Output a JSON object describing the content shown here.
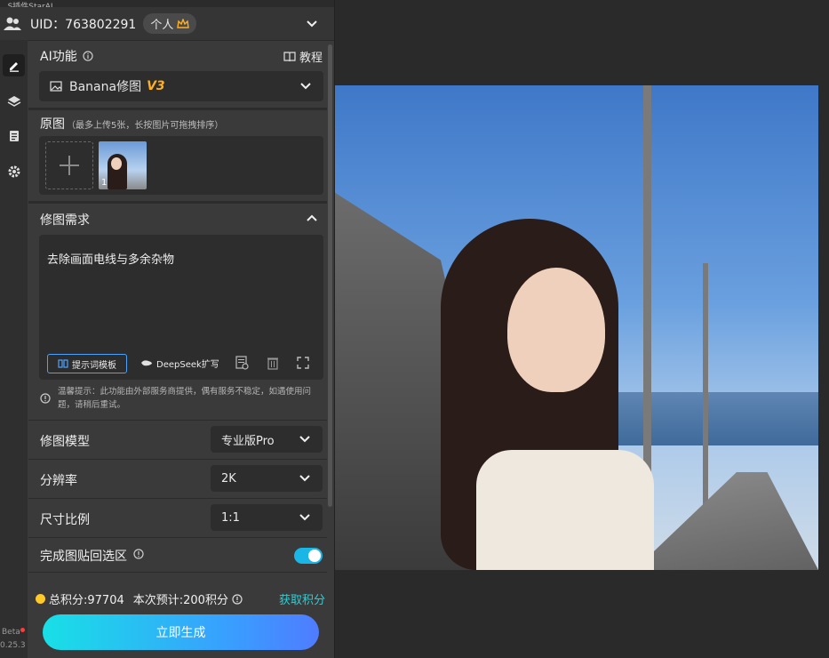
{
  "window": {
    "title": "...S插件StarAI"
  },
  "account": {
    "uid_label": "UID：763802291",
    "tier": "个人"
  },
  "section_ai": {
    "title": "AI功能",
    "tutorial_label": "教程",
    "feature_selected": "Banana修图",
    "feature_version": "V3"
  },
  "section_source": {
    "title": "原图",
    "hint": "（最多上传5张，长按图片可拖拽排序）",
    "thumb_index": "1"
  },
  "section_request": {
    "title": "修图需求",
    "prompt_text": "去除画面电线与多余杂物",
    "template_button": "提示词模板",
    "deepseek_button": "DeepSeek扩写",
    "notice": "温馨提示：此功能由外部服务商提供，偶有服务不稳定，如遇使用问题，请稍后重试。"
  },
  "settings": {
    "model_label": "修图模型",
    "model_value": "专业版Pro",
    "resolution_label": "分辨率",
    "resolution_value": "2K",
    "aspect_label": "尺寸比例",
    "aspect_value": "1:1",
    "paste_back_label": "完成图贴回选区",
    "paste_back_enabled": true
  },
  "footer": {
    "total_points": "总积分:97704",
    "estimate": "本次预计:200积分",
    "get_points": "获取积分",
    "generate_button": "立即生成",
    "beta": "Beta",
    "version": "0.25.3"
  },
  "colors": {
    "accent": "#19b6e6",
    "gradient_start": "#18e0e6",
    "gradient_end": "#4f7cff",
    "link": "#2ad0d8",
    "crown": "#ffb020"
  }
}
